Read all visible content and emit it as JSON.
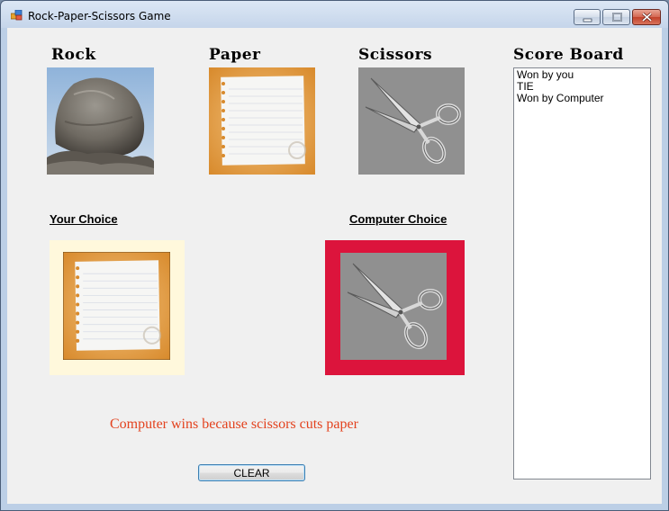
{
  "window": {
    "title": "Rock-Paper-Scissors Game"
  },
  "choices": {
    "rock_label": "Rock",
    "paper_label": "Paper",
    "scissors_label": "Scissors"
  },
  "your_choice_label": "Your Choice",
  "computer_choice_label": "Computer Choice",
  "result_text": "Computer wins because scissors cuts paper",
  "clear_label": "CLEAR",
  "scoreboard": {
    "title": "Score Board",
    "items": [
      "Won by you",
      "TIE",
      "Won by Computer"
    ]
  },
  "colors": {
    "result_text": "#e3421e",
    "your_choice_bg": "#fff8dc",
    "computer_choice_bg": "#dc143c",
    "paper_frame": "#e5a348",
    "scissors_bg": "#909090"
  }
}
